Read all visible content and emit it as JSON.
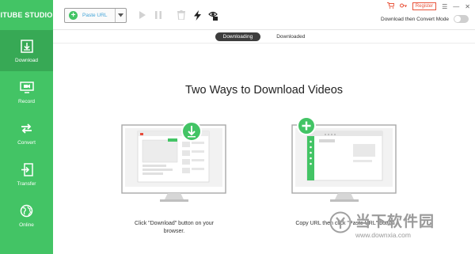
{
  "brand": "ITUBE STUDIO",
  "sidebar": {
    "items": [
      {
        "label": "Download",
        "icon": "download-icon",
        "active": true
      },
      {
        "label": "Record",
        "icon": "record-icon",
        "active": false
      },
      {
        "label": "Convert",
        "icon": "convert-icon",
        "active": false
      },
      {
        "label": "Transfer",
        "icon": "transfer-icon",
        "active": false
      },
      {
        "label": "Online",
        "icon": "online-icon",
        "active": false
      }
    ]
  },
  "toolbar": {
    "paste_label": "Paste URL",
    "register_label": "Register",
    "mode_label": "Download then Convert Mode",
    "mode_enabled": false
  },
  "tabs": [
    {
      "label": "Downloading",
      "active": true
    },
    {
      "label": "Downloaded",
      "active": false
    }
  ],
  "main": {
    "heading": "Two Ways to Download Videos",
    "option1_caption_line1": "Click \"Download\" button on your",
    "option1_caption_line2": "browser.",
    "option2_caption": "Copy URL then click \"Paste URL\" button"
  },
  "watermark": {
    "cn": "当下软件园",
    "url": "www.downxia.com"
  },
  "colors": {
    "accent": "#43c465",
    "accent_dark": "#37a955",
    "register": "#e8533a",
    "link": "#43a4d8"
  }
}
